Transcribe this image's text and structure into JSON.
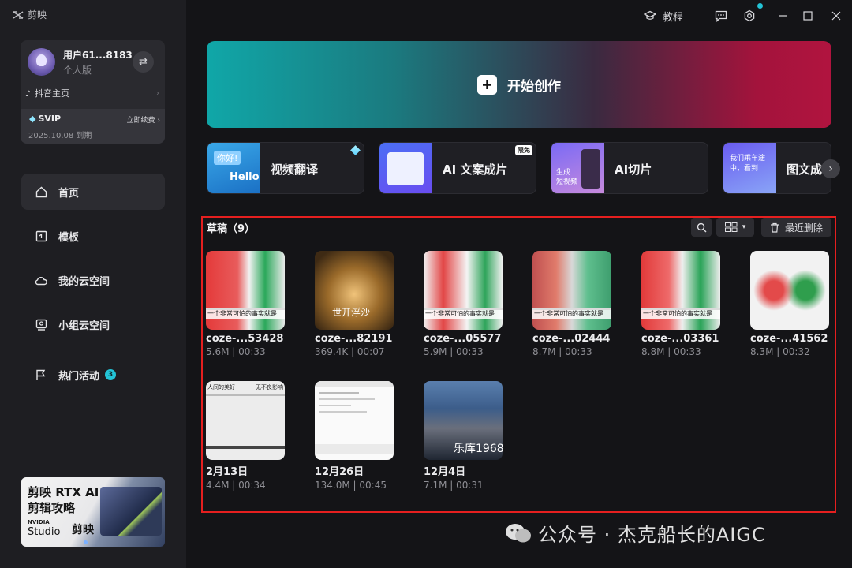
{
  "app": {
    "name": "剪映"
  },
  "user": {
    "name": "用户61...8183",
    "plan": "个人版",
    "douyin_label": "抖音主页",
    "svip_label": "SVIP",
    "renew_label": "立即续费",
    "expire_text": "2025.10.08 到期"
  },
  "nav": {
    "items": [
      {
        "label": "首页",
        "icon": "home-icon"
      },
      {
        "label": "模板",
        "icon": "template-icon"
      },
      {
        "label": "我的云空间",
        "icon": "cloud-icon"
      },
      {
        "label": "小组云空间",
        "icon": "group-cloud-icon"
      },
      {
        "label": "热门活动",
        "icon": "flag-icon",
        "badge": "3"
      }
    ]
  },
  "promo": {
    "line1": "剪映 RTX AI",
    "line2": "剪辑攻略",
    "nvidia": "NVIDIA",
    "studio": "Studio",
    "brand": "剪映"
  },
  "titlebar": {
    "tutorial_label": "教程"
  },
  "start": {
    "label": "开始创作"
  },
  "tools": [
    {
      "label": "视频翻译",
      "thumb_text_1": "你好!",
      "thumb_text_2": "Hello"
    },
    {
      "label": "AI 文案成片",
      "tag": "限免"
    },
    {
      "label": "AI切片",
      "thumb_text_1": "生成",
      "thumb_text_2": "短视频"
    },
    {
      "label": "图文成",
      "thumb_text_1": "我们乘车途中，看到"
    }
  ],
  "drafts": {
    "title": "草稿（9）",
    "recent_delete_label": "最近删除",
    "items": [
      {
        "name": "coze-...53428",
        "meta": "5.6M | 00:33",
        "caption": "一个非常可怕的事实就是"
      },
      {
        "name": "coze-...82191",
        "meta": "369.4K | 00:07",
        "caption": "世开浮沙"
      },
      {
        "name": "coze-...05577",
        "meta": "5.9M | 00:33",
        "caption": "一个非常可怕的事实就是"
      },
      {
        "name": "coze-...02444",
        "meta": "8.7M | 00:33",
        "caption": "一个非常可怕的事实就是"
      },
      {
        "name": "coze-...03361",
        "meta": "8.8M | 00:33",
        "caption": "一个非常可怕的事实就是"
      },
      {
        "name": "coze-...41562",
        "meta": "8.3M | 00:32",
        "caption": ""
      },
      {
        "name": "2月13日",
        "meta": "4.4M | 00:34",
        "caption": "人间的美好",
        "caption2": "无不良影响"
      },
      {
        "name": "12月26日",
        "meta": "134.0M | 00:45",
        "caption": ""
      },
      {
        "name": "12月4日",
        "meta": "7.1M | 00:31",
        "caption": "乐库1968"
      }
    ]
  },
  "watermark": {
    "text": "公众号 · 杰克船长的AIGC"
  },
  "colors": {
    "accent": "#23c3d6",
    "highlight_border": "#e51f1f"
  }
}
